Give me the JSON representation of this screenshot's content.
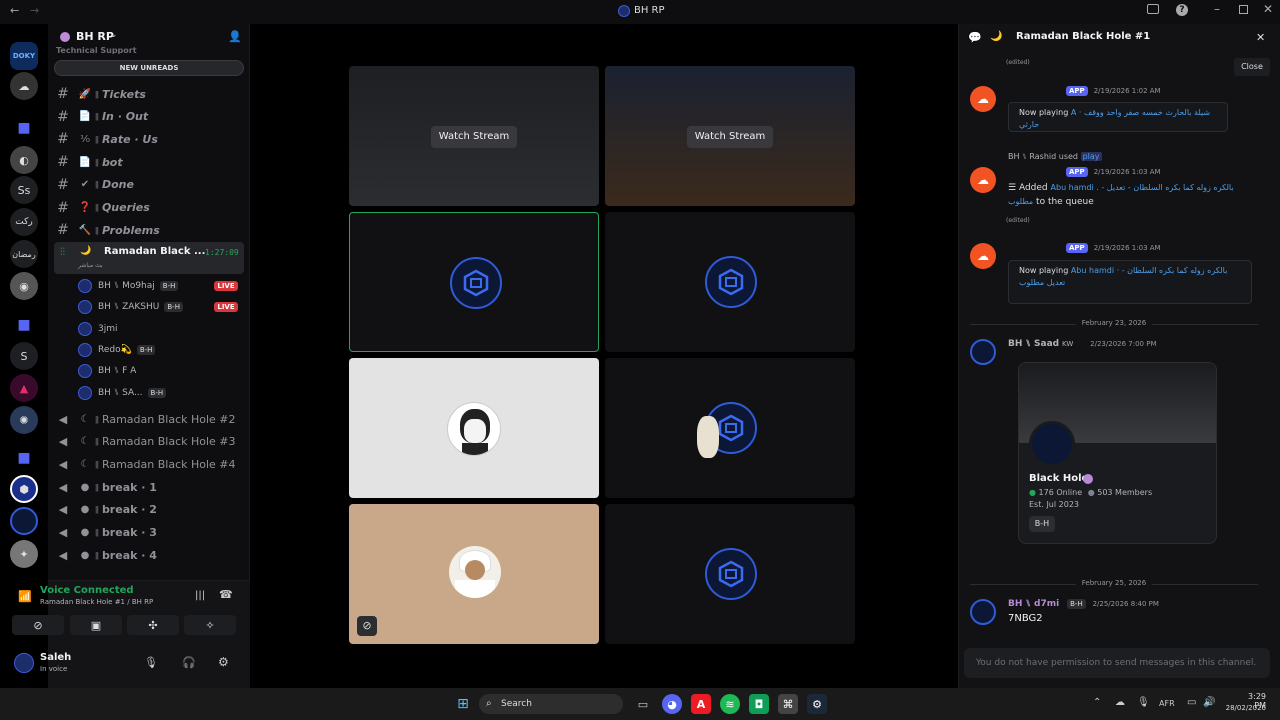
{
  "window": {
    "title": "BH RP"
  },
  "server": {
    "name": "BH RP",
    "new_unreads": "NEW UNREADS",
    "partial_channel": "Technical Support"
  },
  "rail": {
    "items": [
      "Ss",
      "ركت",
      "رمضان",
      "S"
    ]
  },
  "channels": [
    {
      "emoji": "🚀",
      "label": "Tickets"
    },
    {
      "emoji": "📄",
      "label": "In · Out"
    },
    {
      "emoji": "⅟₀",
      "label": "Rate · Us"
    },
    {
      "emoji": "📄",
      "label": "bot"
    },
    {
      "emoji": "✔",
      "label": "Done"
    },
    {
      "emoji": "❓",
      "label": "Queries"
    },
    {
      "emoji": "🔨",
      "label": "Problems"
    }
  ],
  "active_voice": {
    "name": "Ramadan Black ...",
    "timer": "1:27:09",
    "status": "بث مباشر"
  },
  "voice_users": [
    {
      "name": "BH ⑊ Mo9haj",
      "tag": "B-H",
      "live": true
    },
    {
      "name": "BH ⑊ ZAKSHU",
      "tag": "B-H",
      "live": true
    },
    {
      "name": "3jmi",
      "tag": "",
      "live": false
    },
    {
      "name": "Redo💫",
      "tag": "B-H",
      "live": false
    },
    {
      "name": "BH ⑊ F A",
      "tag": "",
      "live": false
    },
    {
      "name": "BH ⑊ SA...",
      "tag": "B-H",
      "live": false
    }
  ],
  "live_label": "LIVE",
  "voice_channels": [
    "Ramadan Black Hole #2",
    "Ramadan Black Hole #3",
    "Ramadan Black Hole #4",
    "break · 1",
    "break · 2",
    "break · 3",
    "break · 4"
  ],
  "voice_connected": {
    "title": "Voice Connected",
    "subtitle": "Ramadan Black Hole #1 / BH RP"
  },
  "user": {
    "name": "Saleh",
    "status": "In voice"
  },
  "stage": {
    "watch_stream": "Watch Stream"
  },
  "panel": {
    "title": "Ramadan Black Hole #1",
    "close_tooltip": "Close",
    "edited": "(edited)",
    "app": "APP",
    "messages": [
      {
        "ts": "2/19/2026 1:02 AM",
        "now_playing": "Now playing",
        "track": "A · شيلة بالحارث خمسه صفر واحد ووقف حارثي"
      },
      {
        "reply_user": "BH ⑊ Rashid",
        "used": "used",
        "command": "play",
        "ts": "2/19/2026 1:03 AM",
        "added": "Added",
        "track": "Abu hamdi . بالكره زوله كما بكره السلطان - تعديل - مطلوب",
        "queue": "to the queue"
      },
      {
        "ts": "2/19/2026 1:03 AM",
        "now_playing": "Now playing",
        "track": "Abu hamdi · بالكره زوله كما بكره السلطان - تعديل مطلوب"
      }
    ],
    "date1": "February 23, 2026",
    "invite_msg": {
      "author": "BH ⑊ Saad",
      "suffix": "KW",
      "ts": "2/23/2026 7:00 PM",
      "server": "Black Hole",
      "online": "176 Online",
      "members": "503 Members",
      "est": "Est. Jul 2023",
      "tag": "B-H"
    },
    "date2": "February 25, 2026",
    "last_msg": {
      "author": "BH ⑊ d7mi",
      "tag": "B-H",
      "ts": "2/25/2026 8:40 PM",
      "text": "7NBG2"
    },
    "input_placeholder": "You do not have permission to send messages in this channel."
  },
  "taskbar": {
    "search": "Search",
    "lang": "AFR",
    "time": "3:29 PM",
    "date": "28/02/2026"
  }
}
